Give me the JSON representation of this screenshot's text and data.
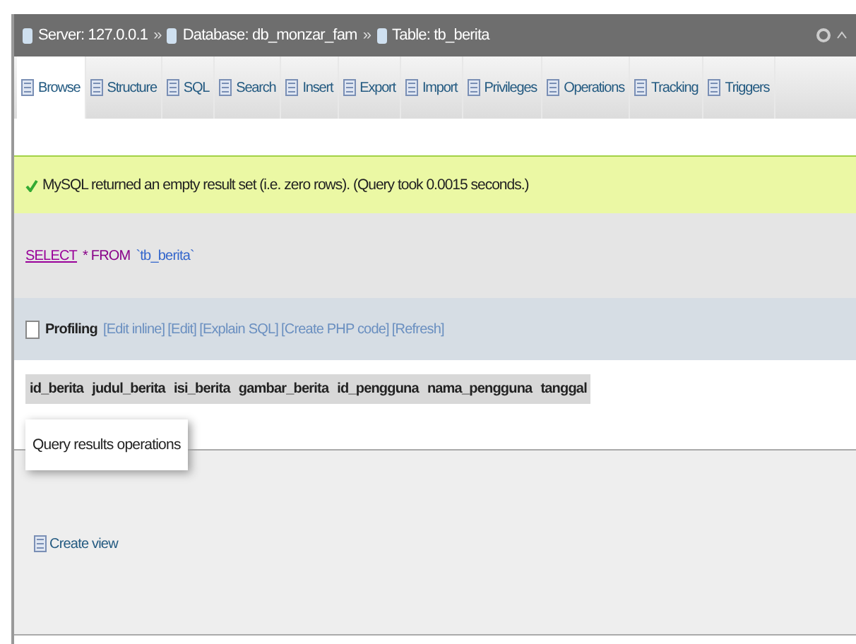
{
  "breadcrumb": [
    {
      "label": "Server: 127.0.0.1"
    },
    {
      "label": "Database: db_monzar_fam"
    },
    {
      "label": "Table: tb_berita"
    }
  ],
  "separator": "»",
  "tabs": [
    {
      "label": "Browse",
      "selected": true
    },
    {
      "label": "Structure",
      "selected": false
    },
    {
      "label": "SQL",
      "selected": false
    },
    {
      "label": "Search",
      "selected": false
    },
    {
      "label": "Insert",
      "selected": false
    },
    {
      "label": "Export",
      "selected": false
    },
    {
      "label": "Import",
      "selected": false
    },
    {
      "label": "Privileges",
      "selected": false
    },
    {
      "label": "Operations",
      "selected": false
    },
    {
      "label": "Tracking",
      "selected": false
    },
    {
      "label": "Triggers",
      "selected": false
    }
  ],
  "message": "MySQL returned an empty result set (i.e. zero rows). (Query took 0.0015 seconds.)",
  "query": {
    "keyword": "SELECT",
    "rest": "* FROM",
    "table": "`tb_berita`"
  },
  "profiling": {
    "label": "Profiling",
    "checked": false,
    "links": [
      "[Edit inline]",
      "[Edit]",
      "[Explain SQL]",
      "[Create PHP code]",
      "[Refresh]"
    ]
  },
  "columns": [
    "id_berita",
    "judul_berita",
    "isi_berita",
    "gambar_berita",
    "id_pengguna",
    "nama_pengguna",
    "tanggal"
  ],
  "operations": {
    "legend": "Query results operations",
    "links": [
      "Create view"
    ]
  }
}
